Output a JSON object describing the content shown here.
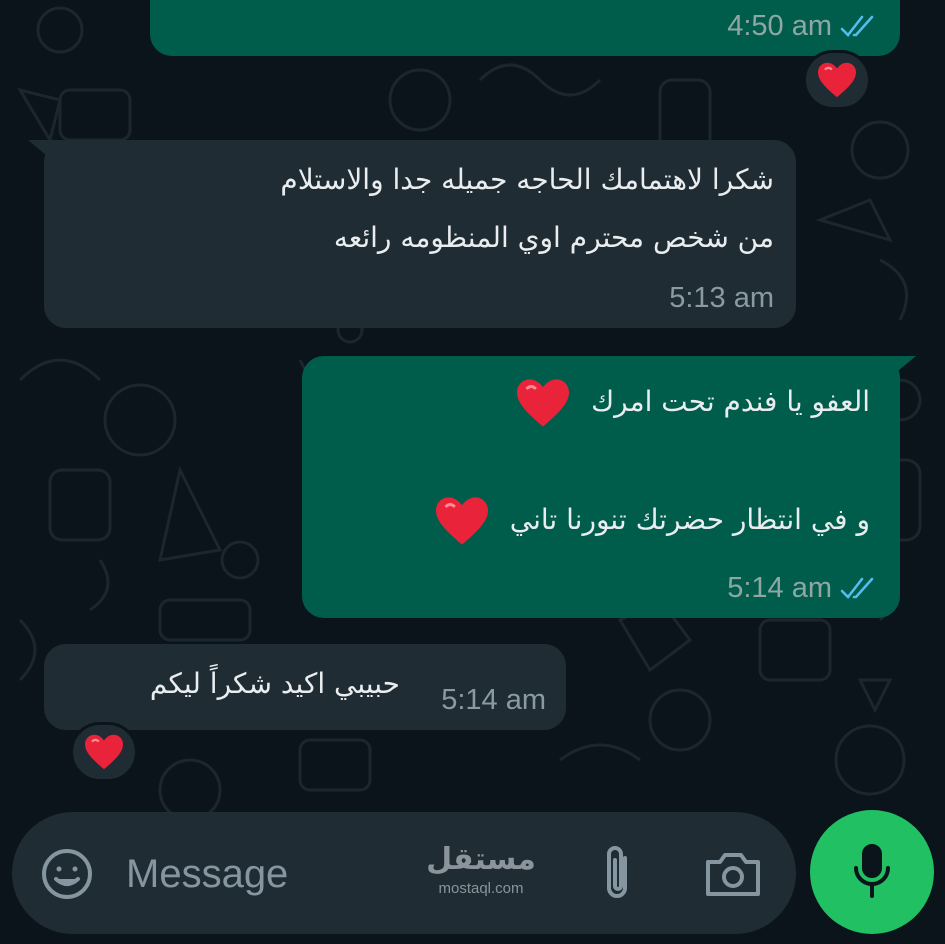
{
  "messages": [
    {
      "direction": "outgoing",
      "text": "",
      "time": "4:50 am",
      "status": "read",
      "reaction": "heart"
    },
    {
      "direction": "incoming",
      "lines": [
        "شكرا لاهتمامك الحاجه جميله جدا والاستلام",
        "من شخص محترم اوي المنظومه رائعه"
      ],
      "time": "5:13 am"
    },
    {
      "direction": "outgoing",
      "lines": [
        "العفو يا فندم تحت امرك",
        "و في انتظار حضرتك تنورنا تاني"
      ],
      "time": "5:14 am",
      "status": "read"
    },
    {
      "direction": "incoming",
      "text": "حبيبي اكيد شكراً ليكم",
      "time": "5:14 am",
      "reaction": "heart"
    }
  ],
  "composer": {
    "placeholder": "Message",
    "icons": {
      "emoji": "emoji-icon",
      "attach": "paperclip-icon",
      "camera": "camera-icon",
      "mic": "microphone-icon"
    }
  },
  "watermark": {
    "brand": "مستقل",
    "domain": "mostaql.com"
  },
  "colors": {
    "background": "#0b141a",
    "outgoing_bubble": "#005c4b",
    "incoming_bubble": "#202c33",
    "read_ticks": "#53bdeb",
    "mic_button": "#21c063",
    "heart": "#e8233a"
  }
}
